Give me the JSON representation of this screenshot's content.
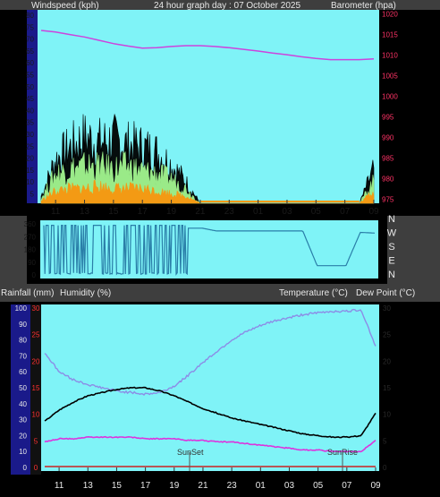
{
  "header": {
    "left_label": "Windspeed (kph)",
    "center_label": "24 hour graph day : 07 October 2025",
    "right_label": "Barometer (hpa)"
  },
  "x_ticks": [
    "11",
    "13",
    "15",
    "17",
    "19",
    "21",
    "23",
    "01",
    "03",
    "05",
    "07",
    "09"
  ],
  "panel1": {
    "left_ticks": [
      "80",
      "75",
      "70",
      "65",
      "60",
      "55",
      "50",
      "45",
      "40",
      "35",
      "30",
      "25",
      "20",
      "15",
      "10",
      "5"
    ],
    "right_ticks": [
      "1020",
      "1015",
      "1010",
      "1005",
      "1000",
      "995",
      "990",
      "985",
      "980",
      "975"
    ]
  },
  "panel2": {
    "left_ticks": [
      "360",
      "270",
      "180",
      "90",
      "0"
    ],
    "compass": [
      "N",
      "W",
      "S",
      "E",
      "N"
    ]
  },
  "panel3": {
    "label_rainfall": "Rainfall (mm)",
    "label_humidity": "Humidity (%)",
    "label_temperature": "Temperature (°C)",
    "label_dewpoint": "Dew Point (°C)",
    "humidity_ticks": [
      "100",
      "90",
      "80",
      "70",
      "60",
      "50",
      "40",
      "30",
      "20",
      "10",
      "0"
    ],
    "rain_ticks": [
      "30",
      "25",
      "20",
      "15",
      "10",
      "5",
      "0"
    ],
    "temp_ticks": [
      "30",
      "25",
      "20",
      "15",
      "10",
      "5",
      "0"
    ],
    "sunset_label": "SunSet",
    "sunrise_label": "SunRise"
  },
  "chart_data": [
    {
      "type": "line",
      "title": "24 hour graph day : 07 October 2025",
      "ylabel": "Windspeed (kph)",
      "y2label": "Barometer (hpa)",
      "x": [
        "10",
        "11",
        "12",
        "13",
        "14",
        "15",
        "16",
        "17",
        "18",
        "19",
        "20",
        "21",
        "22",
        "23",
        "00",
        "01",
        "02",
        "03",
        "04",
        "05",
        "06",
        "07",
        "08",
        "09"
      ],
      "ylim": [
        0,
        80
      ],
      "y2lim": [
        974,
        1021
      ],
      "series": [
        {
          "name": "Windspeed (kph)",
          "axis": "left",
          "color": "#000000",
          "values": [
            3,
            18,
            23,
            27,
            25,
            26,
            24,
            23,
            21,
            16,
            9,
            0,
            0,
            0,
            0,
            0,
            0,
            0,
            0,
            0,
            0,
            0,
            0,
            14
          ]
        },
        {
          "name": "Gust",
          "axis": "left",
          "color": "#9aea88",
          "values": [
            2,
            12,
            14,
            15,
            15,
            14,
            15,
            13,
            12,
            10,
            6,
            0,
            0,
            0,
            0,
            0,
            0,
            0,
            0,
            0,
            0,
            0,
            0,
            9
          ]
        },
        {
          "name": "Average",
          "axis": "left",
          "color": "#f39a14",
          "values": [
            1,
            5,
            6,
            6,
            7,
            6,
            6,
            6,
            5,
            4,
            3,
            0,
            0,
            0,
            0,
            0,
            0,
            0,
            0,
            0,
            0,
            0,
            0,
            5
          ]
        },
        {
          "name": "Barometer (hpa)",
          "axis": "right",
          "color": "#cc44dd",
          "values": [
            1016,
            1015.6,
            1015,
            1014.4,
            1013.6,
            1012.8,
            1012.2,
            1011.7,
            1011.8,
            1012.1,
            1012.3,
            1012.3,
            1012.1,
            1011.8,
            1011.4,
            1011,
            1010.5,
            1010.1,
            1009.6,
            1009.2,
            1008.9,
            1008.9,
            1008.9,
            1009.1
          ]
        }
      ]
    },
    {
      "type": "scatter",
      "ylabel": "Wind direction",
      "x": [
        "10",
        "11",
        "12",
        "13",
        "14",
        "15",
        "16",
        "17",
        "18",
        "19",
        "20",
        "21",
        "22",
        "23",
        "00",
        "01",
        "02",
        "03",
        "04",
        "05",
        "06",
        "07",
        "08",
        "09"
      ],
      "ylim": [
        0,
        360
      ],
      "series": [
        {
          "name": "Wind direction",
          "color": "#2a7ea8",
          "values": [
            200,
            200,
            200,
            200,
            200,
            200,
            200,
            200,
            200,
            200,
            330,
            330,
            310,
            310,
            310,
            310,
            310,
            310,
            310,
            65,
            65,
            65,
            300,
            295
          ]
        }
      ]
    },
    {
      "type": "line",
      "ylabel": "Humidity (%)",
      "y2label": "Temperature (°C)",
      "x": [
        "10",
        "11",
        "12",
        "13",
        "14",
        "15",
        "16",
        "17",
        "18",
        "19",
        "20",
        "21",
        "22",
        "23",
        "00",
        "01",
        "02",
        "03",
        "04",
        "05",
        "06",
        "07",
        "08",
        "09"
      ],
      "ylim": [
        0,
        100
      ],
      "series": [
        {
          "name": "Humidity (%)",
          "color": "#8c8ce6",
          "values": [
            72,
            60,
            55,
            52,
            50,
            48,
            47,
            46,
            47,
            51,
            58,
            66,
            73,
            80,
            85,
            89,
            92,
            94,
            96,
            97,
            98,
            98,
            99,
            76
          ]
        },
        {
          "name": "Temperature (°C)",
          "color": "#000000",
          "values": [
            29,
            36,
            41,
            45,
            47,
            49,
            50,
            50,
            48,
            45,
            41,
            37,
            34,
            31,
            29,
            27,
            25,
            23,
            21,
            20,
            19,
            19,
            20,
            34
          ]
        },
        {
          "name": "Dew Point (°C)",
          "color": "#dd33dd",
          "values": [
            16,
            18,
            18,
            19,
            19,
            19,
            19,
            18,
            18,
            18,
            17,
            17,
            16,
            16,
            15,
            14,
            13,
            12,
            11,
            11,
            10,
            10,
            10,
            17
          ]
        },
        {
          "name": "Rainfall (mm)",
          "color": "#cc2222",
          "values": [
            0,
            0,
            0,
            0,
            0,
            0,
            0,
            0,
            0,
            0,
            0,
            0,
            0,
            0,
            0,
            0,
            0,
            0,
            0,
            0,
            0,
            0,
            0,
            0
          ]
        }
      ]
    }
  ]
}
